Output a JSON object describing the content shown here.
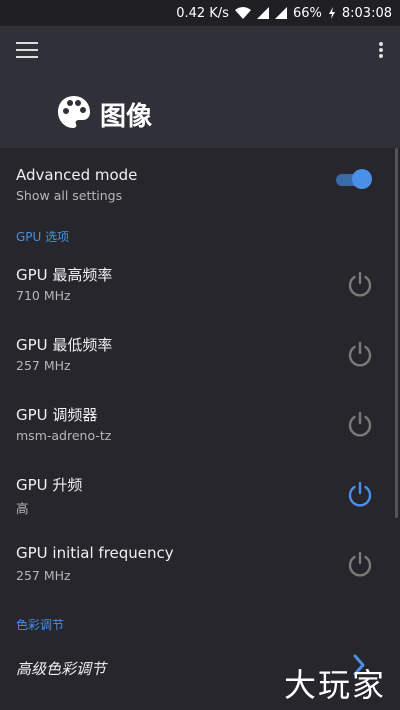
{
  "statusbar": {
    "net_speed": "0.42 K/s",
    "battery": "66%",
    "time": "8:03:08"
  },
  "appbar": {
    "title": "图像"
  },
  "advanced": {
    "title": "Advanced mode",
    "subtitle": "Show all settings",
    "enabled": true
  },
  "sections": {
    "gpu": "GPU 选项",
    "color": "色彩调节"
  },
  "gpu_items": [
    {
      "title": "GPU 最高频率",
      "value": "710 MHz",
      "active": false
    },
    {
      "title": "GPU 最低频率",
      "value": "257 MHz",
      "active": false
    },
    {
      "title": "GPU 调频器",
      "value": "msm-adreno-tz",
      "active": false
    },
    {
      "title": "GPU 升频",
      "value": "高",
      "active": true
    },
    {
      "title": "GPU initial frequency",
      "value": "257 MHz",
      "active": false
    }
  ],
  "color_item": {
    "title": "高级色彩调节"
  },
  "watermark": "大玩家",
  "colors": {
    "accent": "#4a8fe8",
    "background": "#26262c",
    "appbar": "#303038",
    "inactive_icon": "#7a7a7a"
  }
}
